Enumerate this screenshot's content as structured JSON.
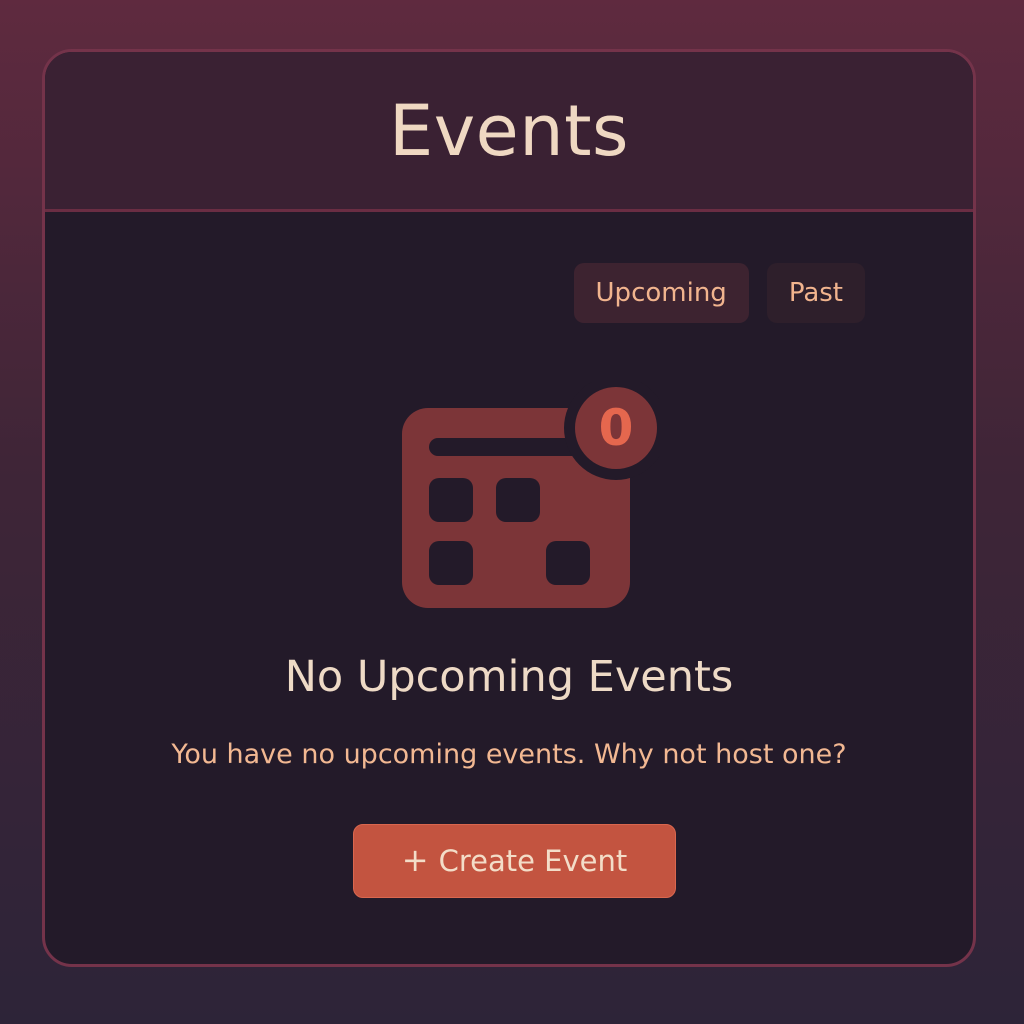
{
  "header": {
    "title": "Events"
  },
  "tabs": [
    {
      "label": "Upcoming",
      "active": true
    },
    {
      "label": "Past",
      "active": false
    }
  ],
  "illustration": {
    "icon": "calendar-icon",
    "badge_count": "0"
  },
  "empty_state": {
    "title": "No Upcoming Events",
    "subtitle": "You have no upcoming events. Why not host one?"
  },
  "actions": {
    "create_icon": "+",
    "create_label": "Create Event"
  },
  "colors": {
    "background_top": "#5f2a3f",
    "background_bottom": "#2d2438",
    "card": "#231a29",
    "header": "#3a2133",
    "border": "#74334a",
    "title_text": "#efd8c2",
    "accent_text": "#f1b48e",
    "calendar": "#7c3538",
    "badge_text": "#e5674e",
    "button": "#c35440"
  }
}
